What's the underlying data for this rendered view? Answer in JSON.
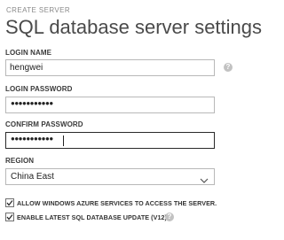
{
  "header": {
    "section": "CREATE SERVER",
    "title": "SQL database server settings"
  },
  "login_name": {
    "label": "LOGIN NAME",
    "value": "hengwei"
  },
  "login_password": {
    "label": "LOGIN PASSWORD",
    "masked_value": "●●●●●●●●●●●"
  },
  "confirm_password": {
    "label": "CONFIRM PASSWORD",
    "masked_value": "●●●●●●●●●●●"
  },
  "region": {
    "label": "REGION",
    "selected": "China East"
  },
  "options": {
    "allow_azure": {
      "label": "ALLOW WINDOWS AZURE SERVICES TO ACCESS THE SERVER.",
      "checked": true
    },
    "latest_update": {
      "label": "ENABLE LATEST SQL DATABASE UPDATE (V12)",
      "checked": true
    }
  },
  "help": {
    "glyph": "?"
  },
  "colors": {
    "focus_border": "#2a2a2a",
    "field_border": "#b8b8b8",
    "help_icon": "#c2c2c2"
  }
}
